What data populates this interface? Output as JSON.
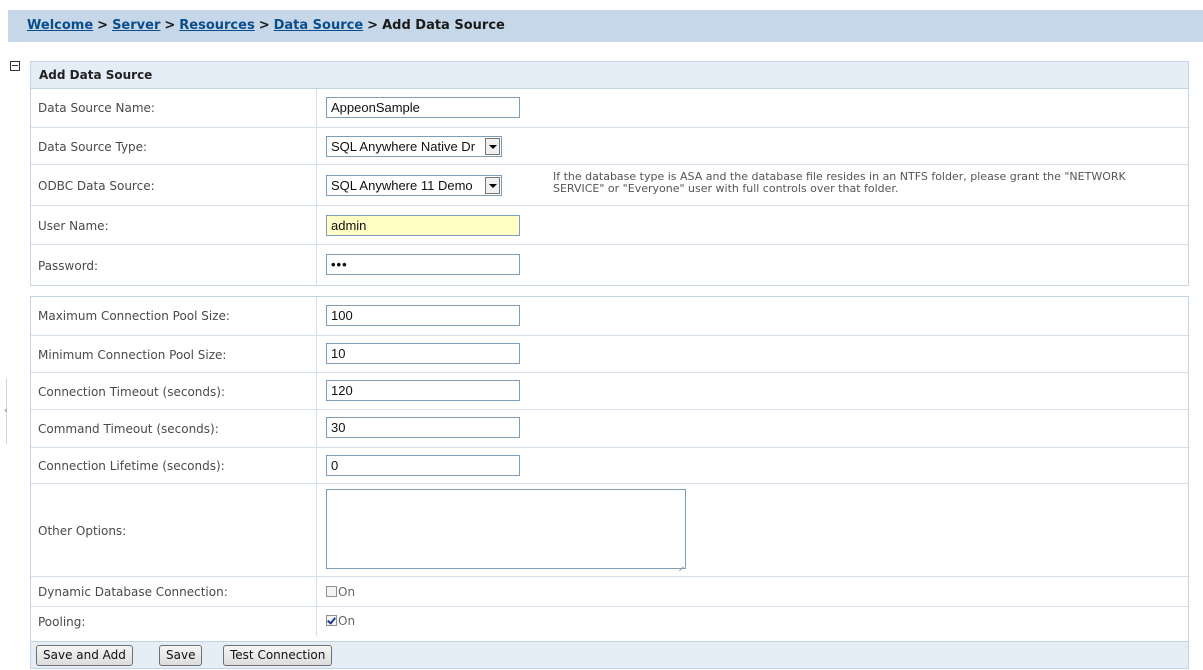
{
  "breadcrumb": {
    "items": [
      "Welcome",
      "Server",
      "Resources",
      "Data Source"
    ],
    "separator": ">",
    "current": "Add Data Source"
  },
  "section": {
    "title": "Add Data Source"
  },
  "fields": {
    "ds_name": {
      "label": "Data Source Name:",
      "value": "AppeonSample"
    },
    "ds_type": {
      "label": "Data Source Type:",
      "value": "SQL Anywhere Native Dr"
    },
    "odbc": {
      "label": "ODBC Data Source:",
      "value": "SQL Anywhere 11 Demo",
      "note": "If the database type is ASA and the database file resides in an NTFS folder, please grant the \"NETWORK SERVICE\" or \"Everyone\" user with full controls over that folder."
    },
    "user": {
      "label": "User Name:",
      "value": "admin"
    },
    "password": {
      "label": "Password:",
      "value": "•••"
    },
    "max_pool": {
      "label": "Maximum Connection Pool Size:",
      "value": "100"
    },
    "min_pool": {
      "label": "Minimum Connection Pool Size:",
      "value": "10"
    },
    "conn_timeout": {
      "label": "Connection Timeout (seconds):",
      "value": "120"
    },
    "cmd_timeout": {
      "label": "Command Timeout (seconds):",
      "value": "30"
    },
    "lifetime": {
      "label": "Connection Lifetime (seconds):",
      "value": "0"
    },
    "other": {
      "label": "Other Options:",
      "value": ""
    },
    "dynamic": {
      "label": "Dynamic Database Connection:",
      "option": "On",
      "checked": false
    },
    "pooling": {
      "label": "Pooling:",
      "option": "On",
      "checked": true
    }
  },
  "buttons": {
    "save_add": "Save and Add",
    "save": "Save",
    "test": "Test Connection"
  },
  "colors": {
    "header_bar": "#c6d7e9",
    "panel_header": "#e5edf6",
    "link": "#0b4d8c",
    "highlight_input": "#ffffc6"
  }
}
